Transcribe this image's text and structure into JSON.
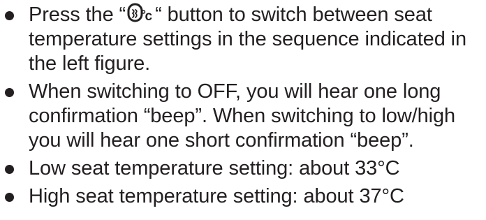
{
  "document": {
    "items": [
      {
        "before_symbol": "Press the “",
        "symbol_icon": "seat-heating-icon",
        "symbol_suffix": "c",
        "after_symbol": "“ button to switch between seat temperature settings in the sequence indicated in the left figure."
      },
      {
        "text": "When switching to OFF, you will hear one long confirmation “beep”. When switching to low/high you will hear one short confirmation “beep”."
      },
      {
        "text": "Low seat temperature setting: about 33°C"
      },
      {
        "text": "High seat temperature setting: about 37°C"
      }
    ]
  }
}
